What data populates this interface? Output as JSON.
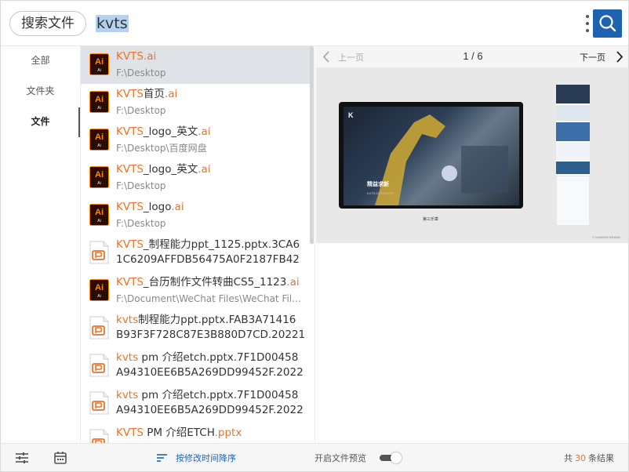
{
  "header": {
    "title": "搜索文件",
    "query": "kvts"
  },
  "nav": {
    "items": [
      {
        "label": "全部",
        "active": false
      },
      {
        "label": "文件夹",
        "active": false
      },
      {
        "label": "文件",
        "active": true
      }
    ]
  },
  "results": [
    {
      "type": "ai",
      "name_hl": "KVTS",
      "name_mid": "",
      "name_ext": ".ai",
      "sub": "F:\\Desktop",
      "sub_style": "path",
      "selected": true
    },
    {
      "type": "ai",
      "name_hl": "KVTS",
      "name_mid": "首页",
      "name_ext": ".ai",
      "sub": "F:\\Desktop",
      "sub_style": "path",
      "selected": false
    },
    {
      "type": "ai",
      "name_hl": "KVTS",
      "name_mid": "_logo_英文",
      "name_ext": ".ai",
      "sub": "F:\\Desktop\\百度网盘",
      "sub_style": "path",
      "selected": false
    },
    {
      "type": "ai",
      "name_hl": "KVTS",
      "name_mid": "_logo_英文",
      "name_ext": ".ai",
      "sub": "F:\\Desktop",
      "sub_style": "path",
      "selected": false
    },
    {
      "type": "ai",
      "name_hl": "KVTS",
      "name_mid": "_logo",
      "name_ext": ".ai",
      "sub": "F:\\Desktop",
      "sub_style": "path",
      "selected": false
    },
    {
      "type": "ppt",
      "name_hl": "KVTS",
      "name_mid": "_制程能力ppt_1125.pptx.3CA6",
      "name_ext": "",
      "sub": "1C6209AFFDB56475A0F2187FB42",
      "sub_style": "wrap",
      "selected": false
    },
    {
      "type": "ai",
      "name_hl": "KVTS",
      "name_mid": "_台历制作文件转曲CS5_1123",
      "name_ext": ".ai",
      "sub": "F:\\Document\\WeChat Files\\WeChat Fil...",
      "sub_style": "path",
      "selected": false
    },
    {
      "type": "ppt",
      "name_hl": "kvts",
      "name_mid": "制程能力ppt.pptx.FAB3A71416",
      "name_ext": "",
      "sub": "B93F3F728C87E3B880D7CD.20221",
      "sub_style": "wrap",
      "selected": false
    },
    {
      "type": "ppt",
      "name_hl": "kvts",
      "name_mid": " pm 介绍etch.pptx.7F1D00458",
      "name_ext": "",
      "sub": "A94310EE6B5A269DD99452F.2022",
      "sub_style": "wrap",
      "selected": false
    },
    {
      "type": "ppt",
      "name_hl": "kvts",
      "name_mid": " pm 介绍etch.pptx.7F1D00458",
      "name_ext": "",
      "sub": "A94310EE6B5A269DD99452F.2022",
      "sub_style": "wrap",
      "selected": false
    },
    {
      "type": "ppt",
      "name_hl": "KVTS",
      "name_mid": " PM 介绍ETCH",
      "name_ext": ".pptx",
      "sub": "",
      "sub_style": "path",
      "selected": false
    }
  ],
  "preview": {
    "prev_label": "上一页",
    "page_indicator": "1 / 6",
    "next_label": "下一页",
    "slide_caption": "精益求新",
    "slide_subcaption": "KVTS KVTS KVTS",
    "slide_label": "第三乐章",
    "credit": "© NANHEN BRAND"
  },
  "footer": {
    "sort_label": "按修改时间降序",
    "preview_toggle_label": "开启文件预览",
    "preview_enabled": true,
    "count_prefix": "共",
    "count": "30",
    "count_suffix": "条结果"
  },
  "colors": {
    "accent": "#1e63b0",
    "highlight": "#e8742d",
    "ai_icon_bg": "#2b0b00",
    "ai_icon_fg": "#ff8a00",
    "ppt_icon": "#e8742d",
    "selected_row": "#dfe3e8"
  }
}
